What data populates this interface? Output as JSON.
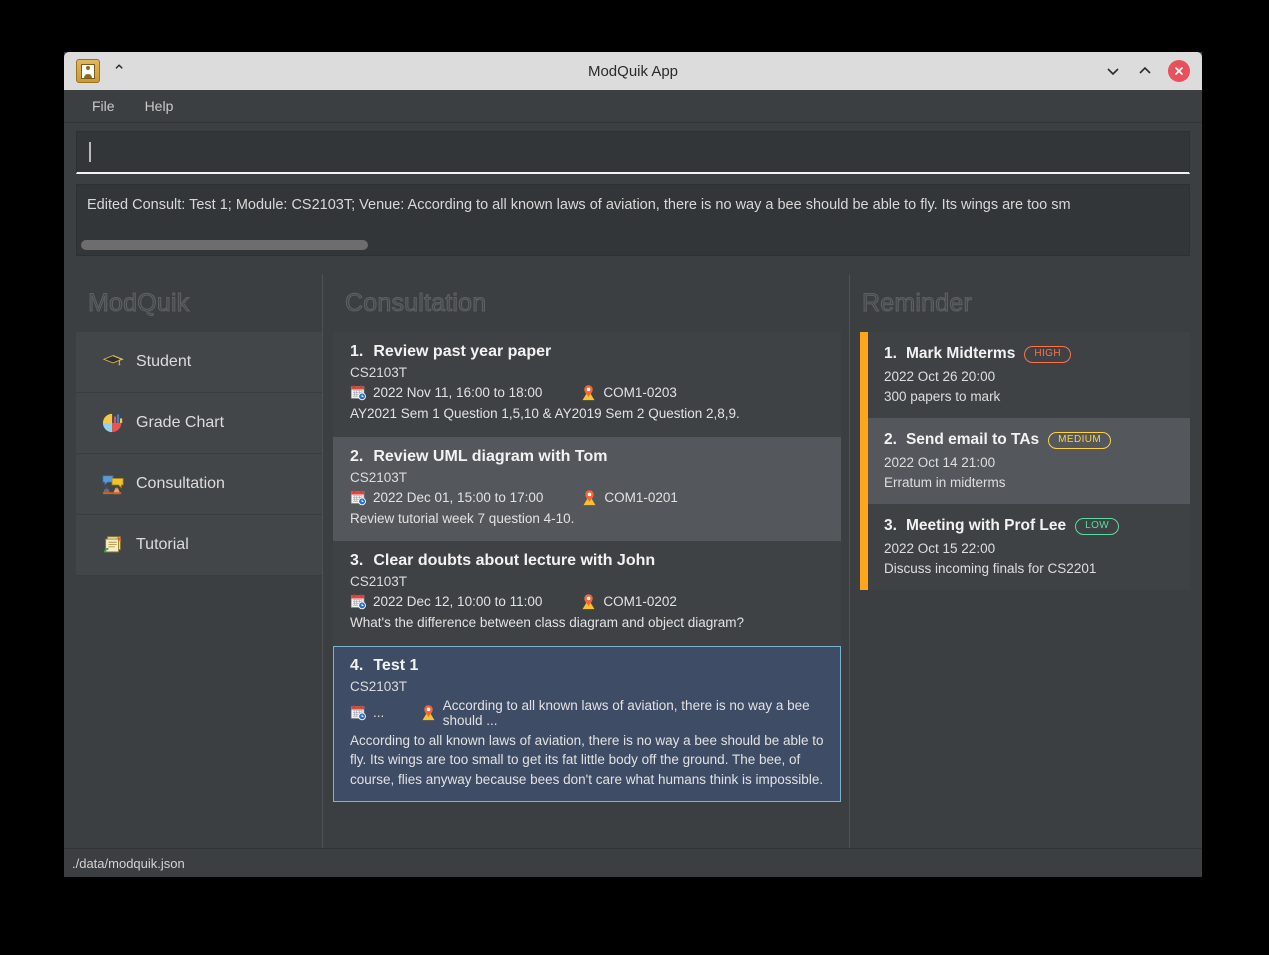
{
  "window": {
    "title": "ModQuik App",
    "app_icon": "contact-book-icon",
    "collapse_icon": "double-chevron-up-icon",
    "controls": {
      "minimize": "chevron-down-icon",
      "maximize": "chevron-up-icon",
      "close": "close-icon"
    }
  },
  "menubar": {
    "items": [
      {
        "label": "File"
      },
      {
        "label": "Help"
      }
    ]
  },
  "command_box": {
    "value": "",
    "placeholder": ""
  },
  "result_box": {
    "text": "Edited Consult: Test 1; Module: CS2103T; Venue: According to all known laws of aviation, there is no way a bee should be able to fly. Its wings are too sm",
    "scroll_thumb_percent": 26
  },
  "sidebar": {
    "title": "ModQuik",
    "items": [
      {
        "label": "Student",
        "icon": "graduation-cap-icon"
      },
      {
        "label": "Grade Chart",
        "icon": "pie-chart-icon"
      },
      {
        "label": "Consultation",
        "icon": "speech-bubbles-icon"
      },
      {
        "label": "Tutorial",
        "icon": "books-icon"
      }
    ]
  },
  "consultation": {
    "title": "Consultation",
    "items": [
      {
        "index": "1.",
        "name": "Review past year paper",
        "module": "CS2103T",
        "date": "2022 Nov 11, 16:00 to 18:00",
        "venue": "COM1-0203",
        "description": "AY2021 Sem 1 Question 1,5,10 & AY2019 Sem 2 Question 2,8,9.",
        "selected": false
      },
      {
        "index": "2.",
        "name": "Review UML diagram with Tom",
        "module": "CS2103T",
        "date": "2022 Dec 01, 15:00 to 17:00",
        "venue": "COM1-0201",
        "description": "Review tutorial week 7 question 4-10.",
        "selected": false
      },
      {
        "index": "3.",
        "name": "Clear doubts about lecture with John",
        "module": "CS2103T",
        "date": "2022 Dec 12, 10:00 to 11:00",
        "venue": "COM1-0202",
        "description": "What's the difference between class diagram and object diagram?",
        "selected": false
      },
      {
        "index": "4.",
        "name": "Test 1",
        "module": "CS2103T",
        "date": "...",
        "venue": "According to all known laws of aviation, there is no way a bee should ...",
        "description": "According to all known laws of aviation, there is no way a bee should be able to fly. Its wings are too small to get its fat little body off the ground. The bee, of course, flies anyway because bees don't care what humans think is impossible.",
        "selected": true
      }
    ],
    "icons": {
      "date": "calendar-clock-icon",
      "venue": "location-pin-icon"
    }
  },
  "reminder": {
    "title": "Reminder",
    "accent_color": "#ffa41b",
    "items": [
      {
        "index": "1.",
        "name": "Mark Midterms",
        "priority": "HIGH",
        "priority_color": "#ff7043",
        "date": "2022 Oct 26 20:00",
        "description": "300 papers to mark"
      },
      {
        "index": "2.",
        "name": "Send email to TAs",
        "priority": "MEDIUM",
        "priority_color": "#ffd23f",
        "date": "2022 Oct 14 21:00",
        "description": "Erratum in midterms"
      },
      {
        "index": "3.",
        "name": "Meeting with Prof Lee",
        "priority": "LOW",
        "priority_color": "#57dba0",
        "date": "2022 Oct 15 22:00",
        "description": "Discuss incoming finals for CS2201"
      }
    ]
  },
  "statusbar": {
    "path": "./data/modquik.json"
  }
}
